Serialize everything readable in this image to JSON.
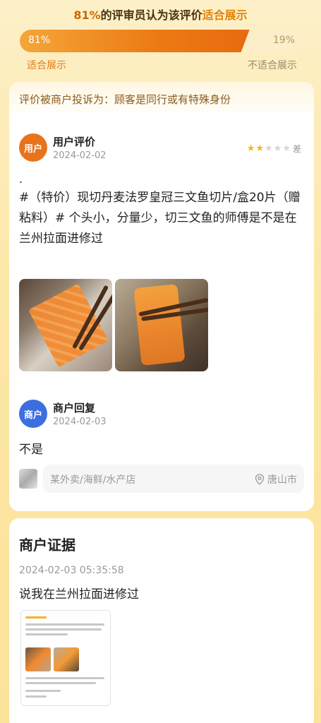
{
  "header": {
    "pct": "81%",
    "mid": "的评审员认为该评价",
    "highlight": "适合展示"
  },
  "vote": {
    "suitable_fraction": 0.81,
    "suitable_pct": "81%",
    "unsuitable_pct": "19%",
    "suitable_label": "适合展示",
    "unsuitable_label": "不适合展示"
  },
  "review": {
    "complaint": "评价被商户投诉为：顾客是同行或有特殊身份",
    "user": {
      "avatar_label": "用户",
      "name": "用户评价",
      "date": "2024-02-02",
      "stars": 2,
      "max_stars": 5,
      "rating_label": "差"
    },
    "dot": ".",
    "text": "#（特价）现切丹麦法罗皇冠三文鱼切片/盒20片（赠粘料）# 个头小，分量少，切三文鱼的师傅是不是在兰州拉面￼进修过",
    "photos": [
      "salmon-photo-1",
      "salmon-photo-2"
    ],
    "merchant": {
      "avatar_label": "商户",
      "name": "商户回复",
      "date": "2024-02-03",
      "reply": "不是"
    },
    "store": {
      "category": "某外卖/海鲜/水产店",
      "location": "唐山市",
      "location_icon": "location-pin-icon"
    }
  },
  "evidence": {
    "title": "商户证据",
    "timestamp": "2024-02-03 05:35:58",
    "text": "说我在兰州拉面进修过"
  },
  "colors": {
    "accent": "#e8731a",
    "merchant": "#3b6fe0",
    "star": "#f5b51b"
  }
}
